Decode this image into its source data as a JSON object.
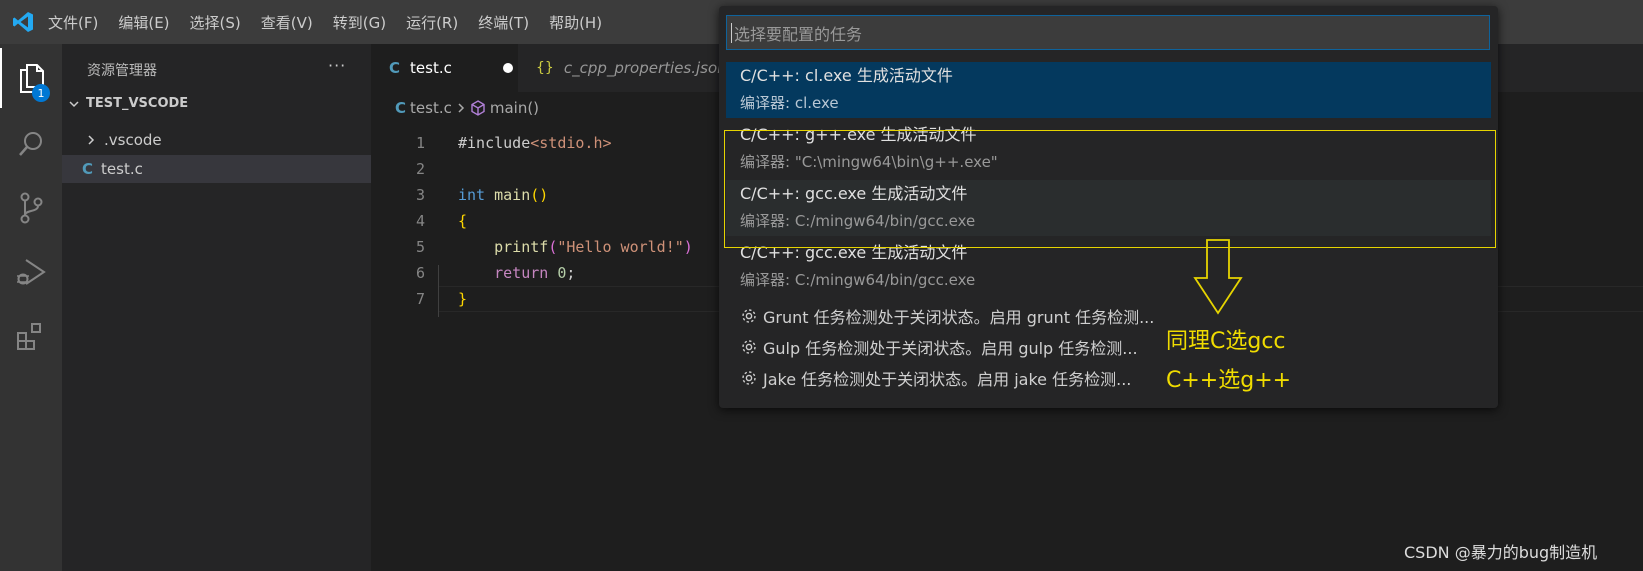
{
  "menu": [
    "文件(F)",
    "编辑(E)",
    "选择(S)",
    "查看(V)",
    "转到(G)",
    "运行(R)",
    "终端(T)",
    "帮助(H)"
  ],
  "activity": {
    "badge": "1"
  },
  "sidebar": {
    "title": "资源管理器",
    "more": "···",
    "section": "TEST_VSCODE",
    "items": [
      {
        "label": ".vscode",
        "icon": "chevron-right-icon"
      },
      {
        "label": "test.c",
        "icon": "c-file-icon"
      }
    ]
  },
  "tabs": [
    {
      "label": "test.c",
      "icon": "C"
    },
    {
      "label": "c_cpp_properties.json",
      "icon": "{}"
    }
  ],
  "breadcrumb": {
    "file": "test.c",
    "symbol": "main()"
  },
  "code": {
    "lines": [
      {
        "n": "1",
        "parts": [
          [
            "#include",
            "#cccccc"
          ],
          [
            "<stdio.h>",
            "#ce9178"
          ]
        ]
      },
      {
        "n": "2",
        "parts": []
      },
      {
        "n": "3",
        "parts": [
          [
            "int",
            "#569cd6"
          ],
          [
            " ",
            "#cccccc"
          ],
          [
            "main",
            "#dcdcaa"
          ],
          [
            "()",
            "#ffd700"
          ]
        ]
      },
      {
        "n": "4",
        "parts": [
          [
            "{",
            "#ffd700"
          ]
        ]
      },
      {
        "n": "5",
        "parts": [
          [
            "    ",
            "#cccccc"
          ],
          [
            "printf",
            "#dcdcaa"
          ],
          [
            "(",
            "#da70d6"
          ],
          [
            "\"Hello world!\"",
            "#ce9178"
          ],
          [
            ")",
            "#da70d6"
          ]
        ]
      },
      {
        "n": "6",
        "parts": [
          [
            "    ",
            "#cccccc"
          ],
          [
            "return",
            "#c586c0"
          ],
          [
            " ",
            "#cccccc"
          ],
          [
            "0",
            "#b5cea8"
          ],
          [
            ";",
            "#cccccc"
          ]
        ]
      },
      {
        "n": "7",
        "parts": [
          [
            "}",
            "#ffd700"
          ]
        ]
      }
    ]
  },
  "quickpick": {
    "placeholder": "选择要配置的任务",
    "items": [
      {
        "title": "C/C++: cl.exe 生成活动文件",
        "detail": "编译器: cl.exe"
      },
      {
        "title": "C/C++: g++.exe 生成活动文件",
        "detail": "编译器: \"C:\\mingw64\\bin\\g++.exe\""
      },
      {
        "title": "C/C++: gcc.exe 生成活动文件",
        "detail": "编译器: C:/mingw64/bin/gcc.exe"
      },
      {
        "title": "C/C++: gcc.exe 生成活动文件",
        "detail": "编译器: C:/mingw64/bin/gcc.exe"
      }
    ],
    "gear_items": [
      "Grunt 任务检测处于关闭状态。启用 grunt 任务检测...",
      "Gulp 任务检测处于关闭状态。启用 gulp 任务检测...",
      "Jake 任务检测处于关闭状态。启用 jake 任务检测..."
    ]
  },
  "annotation": {
    "line1": "同理C选gcc",
    "line2": "C++选g++"
  },
  "watermark": "CSDN @暴力的bug制造机"
}
